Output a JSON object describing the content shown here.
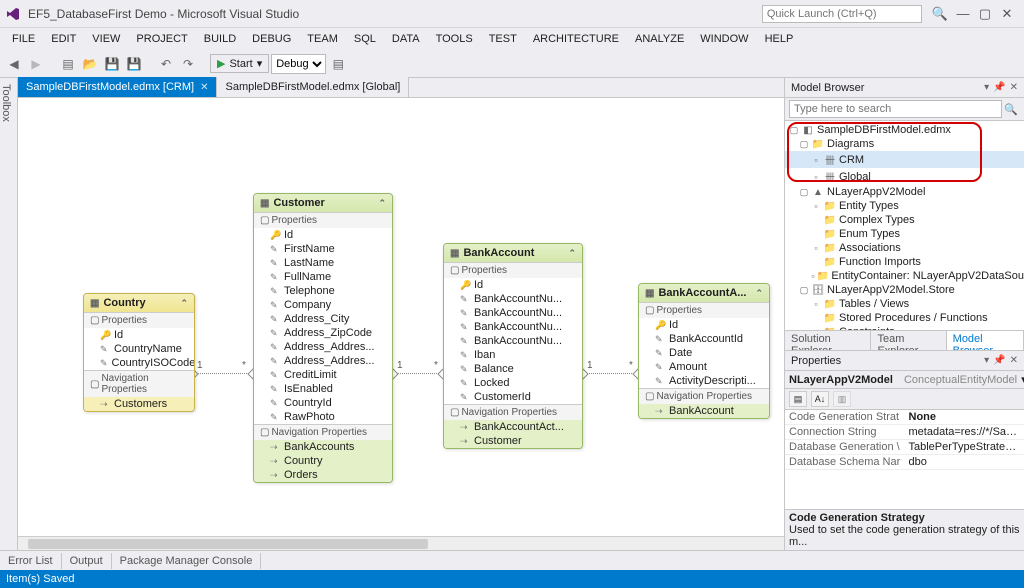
{
  "window": {
    "title": "EF5_DatabaseFirst Demo - Microsoft Visual Studio",
    "quick_launch_ph": "Quick Launch (Ctrl+Q)"
  },
  "menu": [
    "FILE",
    "EDIT",
    "VIEW",
    "PROJECT",
    "BUILD",
    "DEBUG",
    "TEAM",
    "SQL",
    "DATA",
    "TOOLS",
    "TEST",
    "ARCHITECTURE",
    "ANALYZE",
    "WINDOW",
    "HELP"
  ],
  "toolbar": {
    "start": "Start",
    "config": "Debug"
  },
  "vtab": {
    "toolbox": "Toolbox"
  },
  "doc_tabs": [
    {
      "label": "SampleDBFirstModel.edmx [CRM]",
      "active": true
    },
    {
      "label": "SampleDBFirstModel.edmx [Global]",
      "active": false
    }
  ],
  "entities": {
    "country": {
      "name": "Country",
      "sections": {
        "props_hdr": "Properties",
        "props": [
          "Id",
          "CountryName",
          "CountryISOCode"
        ],
        "nav_hdr": "Navigation Properties",
        "navs": [
          "Customers"
        ]
      }
    },
    "customer": {
      "name": "Customer",
      "sections": {
        "props_hdr": "Properties",
        "props": [
          "Id",
          "FirstName",
          "LastName",
          "FullName",
          "Telephone",
          "Company",
          "Address_City",
          "Address_ZipCode",
          "Address_Addres...",
          "Address_Addres...",
          "CreditLimit",
          "IsEnabled",
          "CountryId",
          "RawPhoto"
        ],
        "nav_hdr": "Navigation Properties",
        "navs": [
          "BankAccounts",
          "Country",
          "Orders"
        ]
      }
    },
    "bankaccount": {
      "name": "BankAccount",
      "sections": {
        "props_hdr": "Properties",
        "props": [
          "Id",
          "BankAccountNu...",
          "BankAccountNu...",
          "BankAccountNu...",
          "BankAccountNu...",
          "Iban",
          "Balance",
          "Locked",
          "CustomerId"
        ],
        "nav_hdr": "Navigation Properties",
        "navs": [
          "BankAccountAct...",
          "Customer"
        ]
      }
    },
    "bankaccountact": {
      "name": "BankAccountA...",
      "sections": {
        "props_hdr": "Properties",
        "props": [
          "Id",
          "BankAccountId",
          "Date",
          "Amount",
          "ActivityDescripti..."
        ],
        "nav_hdr": "Navigation Properties",
        "navs": [
          "BankAccount"
        ]
      }
    }
  },
  "cardinality": {
    "one": "1",
    "many": "*"
  },
  "model_browser": {
    "title": "Model Browser",
    "search_ph": "Type here to search",
    "tree": {
      "root": "SampleDBFirstModel.edmx",
      "diagrams": "Diagrams",
      "crm": "CRM",
      "global": "Global",
      "model": "NLayerAppV2Model",
      "entity_types": "Entity Types",
      "complex_types": "Complex Types",
      "enum_types": "Enum Types",
      "associations": "Associations",
      "function_imports": "Function Imports",
      "entity_container": "EntityContainer: NLayerAppV2DataSou",
      "store": "NLayerAppV2Model.Store",
      "tables": "Tables / Views",
      "sprocs": "Stored Procedures / Functions",
      "constraints": "Constraints"
    },
    "tabs": [
      "Solution Explorer",
      "Team Explorer",
      "Model Browser"
    ]
  },
  "properties": {
    "title": "Properties",
    "object": {
      "name": "NLayerAppV2Model",
      "type": "ConceptualEntityModel"
    },
    "rows": [
      {
        "k": "Code Generation Strat",
        "v": "None"
      },
      {
        "k": "Connection String",
        "v": "metadata=res://*/Sampl"
      },
      {
        "k": "Database Generation \\",
        "v": "TablePerTypeStrategy.xa"
      },
      {
        "k": "Database Schema Nar",
        "v": "dbo"
      }
    ],
    "desc_title": "Code Generation Strategy",
    "desc_text": "Used to set the code generation strategy of this m..."
  },
  "bottom_tabs": [
    "Error List",
    "Output",
    "Package Manager Console"
  ],
  "status": "Item(s) Saved"
}
